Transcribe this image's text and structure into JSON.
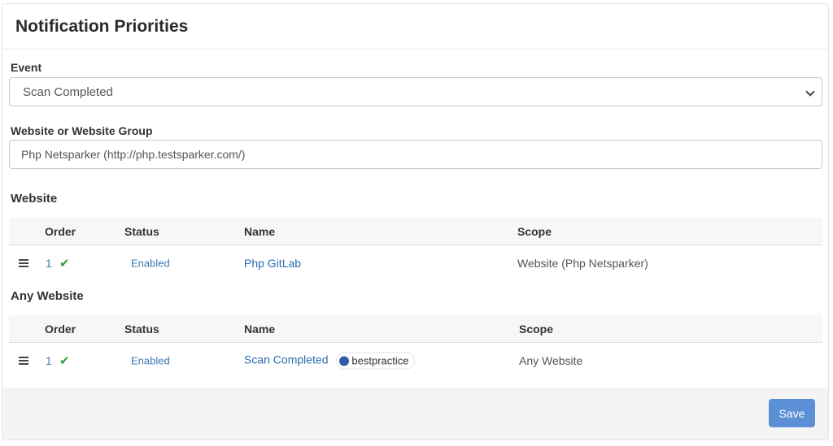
{
  "header": {
    "title": "Notification Priorities"
  },
  "form": {
    "event_label": "Event",
    "event_value": "Scan Completed",
    "website_label": "Website or Website Group",
    "website_value": "Php Netsparker (http://php.testsparker.com/)"
  },
  "sections": {
    "website": {
      "title": "Website",
      "columns": [
        "Order",
        "Status",
        "Name",
        "Scope"
      ],
      "rows": [
        {
          "order": "1",
          "status": "Enabled",
          "name": "Php GitLab",
          "scope": "Website (Php Netsparker)"
        }
      ]
    },
    "any_website": {
      "title": "Any Website",
      "columns": [
        "Order",
        "Status",
        "Name",
        "Scope"
      ],
      "rows": [
        {
          "order": "1",
          "status": "Enabled",
          "name": "Scan Completed",
          "badge": "bestpractice",
          "scope": "Any Website"
        }
      ]
    }
  },
  "footer": {
    "save_label": "Save"
  },
  "icons": {
    "drag": "drag-handle-icon",
    "check": "check-icon",
    "chevron": "chevron-down-icon",
    "badge": "badge-icon"
  },
  "colors": {
    "link": "#2a6bb0",
    "check": "#2e9d3a",
    "save_button": "#5b8fd6"
  }
}
